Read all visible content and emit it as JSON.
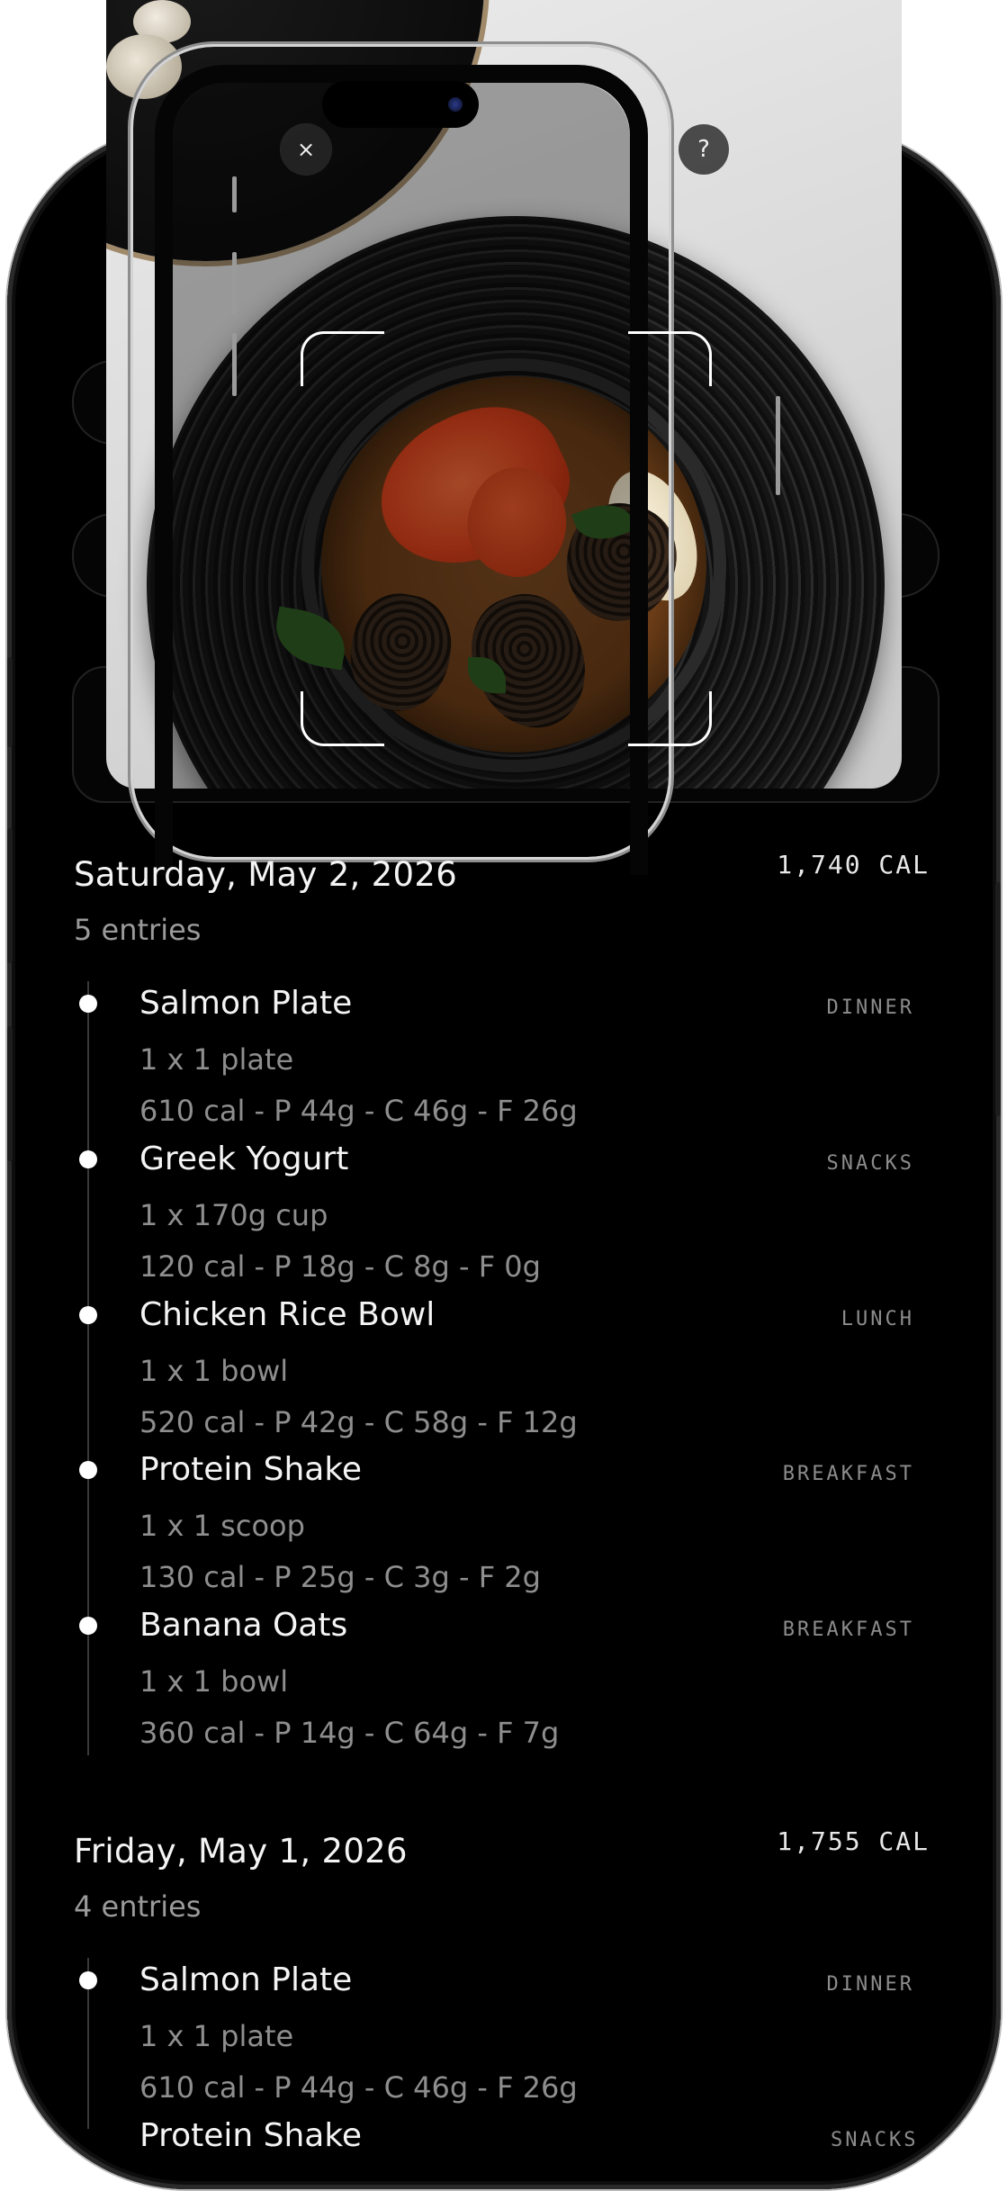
{
  "camera": {
    "close_icon": "×",
    "help_icon": "?"
  },
  "days": [
    {
      "date": "Saturday, May 2, 2026",
      "entry_count": "5 entries",
      "total": "1,740 CAL",
      "entries": [
        {
          "name": "Salmon Plate",
          "serving": "1 x 1 plate",
          "macros": "610 cal - P 44g - C 46g - F 26g",
          "meal": "DINNER"
        },
        {
          "name": "Greek Yogurt",
          "serving": "1 x 170g cup",
          "macros": "120 cal - P 18g - C 8g - F 0g",
          "meal": "SNACKS"
        },
        {
          "name": "Chicken Rice Bowl",
          "serving": "1 x 1 bowl",
          "macros": "520 cal - P 42g - C 58g - F 12g",
          "meal": "LUNCH"
        },
        {
          "name": "Protein Shake",
          "serving": "1 x 1 scoop",
          "macros": "130 cal - P 25g - C 3g - F 2g",
          "meal": "BREAKFAST"
        },
        {
          "name": "Banana Oats",
          "serving": "1 x 1 bowl",
          "macros": "360 cal - P 14g - C 64g - F 7g",
          "meal": "BREAKFAST"
        }
      ]
    },
    {
      "date": "Friday, May 1, 2026",
      "entry_count": "4 entries",
      "total": "1,755 CAL",
      "entries": [
        {
          "name": "Salmon Plate",
          "serving": "1 x 1 plate",
          "macros": "610 cal - P 44g - C 46g - F 26g",
          "meal": "DINNER"
        },
        {
          "name": "Protein Shake",
          "meal": "SNACKS"
        }
      ]
    }
  ]
}
